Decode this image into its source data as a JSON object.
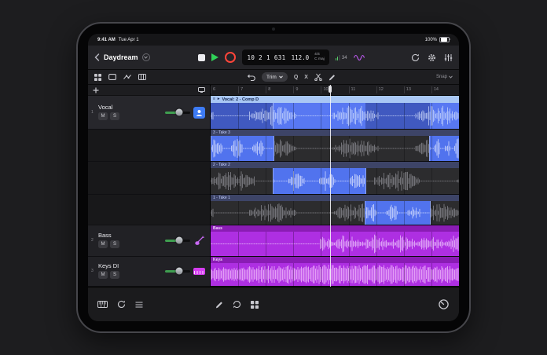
{
  "status": {
    "time": "9:41 AM",
    "date": "Tue Apr 1",
    "battery": "100%"
  },
  "topbar": {
    "title": "Daydream",
    "lcd": {
      "position": "10 2 1 631",
      "tempo": "112.0",
      "timesig": "4/4",
      "key": "C maj",
      "cpu": "34"
    }
  },
  "editbar": {
    "tool": "Trim",
    "quantize": "Q",
    "crossfade": "X",
    "snap": "Snap"
  },
  "ruler": {
    "bars": [
      "6",
      "7",
      "8",
      "9",
      "10",
      "11",
      "12",
      "13",
      "14"
    ]
  },
  "tracks": [
    {
      "num": "1",
      "name": "Vocal",
      "mute": "M",
      "solo": "S"
    },
    {
      "num": "2",
      "name": "Bass",
      "mute": "M",
      "solo": "S"
    },
    {
      "num": "3",
      "name": "Keys DI",
      "mute": "M",
      "solo": "S"
    }
  ],
  "regions": {
    "comp": {
      "label": "Vocal: 2 - Comp D",
      "segments": [
        {
          "s": 0.0,
          "e": 0.25,
          "tone": "med"
        },
        {
          "s": 0.25,
          "e": 0.47,
          "tone": "bright"
        },
        {
          "s": 0.47,
          "e": 0.62,
          "tone": "bright"
        },
        {
          "s": 0.62,
          "e": 0.88,
          "tone": "med"
        },
        {
          "s": 0.88,
          "e": 1.0,
          "tone": "bright"
        }
      ]
    },
    "takes": [
      {
        "label": "3 - Take 3",
        "selected": [
          {
            "s": 0.0,
            "e": 0.25
          },
          {
            "s": 0.88,
            "e": 1.0
          }
        ]
      },
      {
        "label": "2 - Take 2",
        "selected": [
          {
            "s": 0.25,
            "e": 0.62
          }
        ]
      },
      {
        "label": "1 - Take 1",
        "selected": [
          {
            "s": 0.62,
            "e": 0.88
          }
        ]
      }
    ],
    "bass": {
      "label": "Bass"
    },
    "keys": {
      "label": "Keys"
    }
  },
  "playhead": {
    "bar_fraction": 0.48
  },
  "colors": {
    "play_green": "#30d158",
    "record_red": "#ff453a",
    "region_blue_bright": "#5878f2",
    "region_blue_med": "#4059c0",
    "take_selected_blue": "#5173ee",
    "region_magenta": "#ae2fe2",
    "comp_header_blue": "#a9c7f4",
    "tuner_purple": "#bf5af2"
  }
}
